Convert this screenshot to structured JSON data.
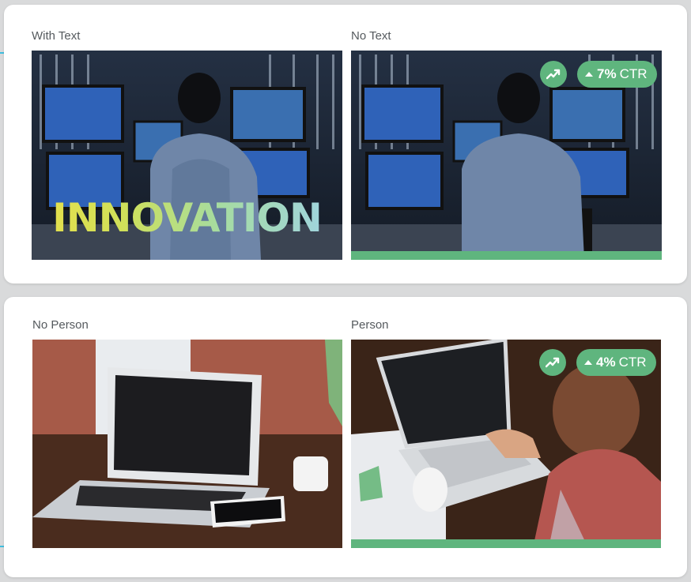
{
  "comparisons": [
    {
      "left": {
        "label": "With Text",
        "overlay_text": "INNOVATION"
      },
      "right": {
        "label": "No Text",
        "ctr_value": "7%",
        "ctr_label": "CTR",
        "winner": true
      }
    },
    {
      "left": {
        "label": "No Person"
      },
      "right": {
        "label": "Person",
        "ctr_value": "4%",
        "ctr_label": "CTR",
        "winner": true
      }
    }
  ],
  "colors": {
    "win_green": "#5fb57e",
    "connector_cyan": "#3fbfe0",
    "card_bg": "#ffffff",
    "page_bg": "#d9dadb"
  },
  "icons": {
    "trend": "trending-up-icon",
    "delta": "triangle-up-icon"
  }
}
